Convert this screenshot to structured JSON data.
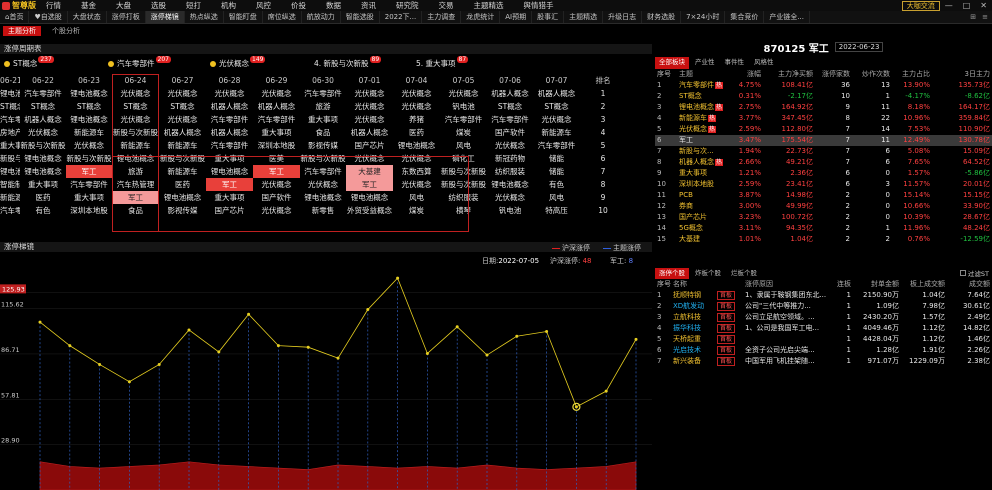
{
  "app": {
    "logo": "智尊版"
  },
  "menu": [
    "行情",
    "基金",
    "大盘",
    "选股",
    "短打",
    "机构",
    "风控",
    "价投",
    "数据",
    "资讯",
    "研究院",
    "交易",
    "主题精选",
    "舆情猎手"
  ],
  "help_label": "大咖交流",
  "win_controls": [
    "—",
    "□",
    "✕"
  ],
  "tabs": [
    {
      "label": "首页",
      "icon": "home-icon"
    },
    {
      "label": "自选股",
      "icon": "heart-icon"
    },
    {
      "label": "大盘状态"
    },
    {
      "label": "涨停打板"
    },
    {
      "label": "涨停梯镜",
      "active": true
    },
    {
      "label": "热点纵选"
    },
    {
      "label": "智能盯盘"
    },
    {
      "label": "席位纵选"
    },
    {
      "label": "航放动力"
    },
    {
      "label": "智能选股"
    },
    {
      "label": "2022下..."
    },
    {
      "label": "主力调查"
    },
    {
      "label": "龙虎统计"
    },
    {
      "label": "AI预期"
    },
    {
      "label": "股事汇"
    },
    {
      "label": "主题精选"
    },
    {
      "label": "升级日志"
    },
    {
      "label": "财务选股"
    },
    {
      "label": "7×24小时"
    },
    {
      "label": "集合竞价"
    },
    {
      "label": "产业链全..."
    }
  ],
  "subtabs": [
    {
      "label": "主题分析",
      "active": true
    },
    {
      "label": "个股分析"
    }
  ],
  "left": {
    "title": "涨停周期表",
    "top_themes": [
      {
        "name": "ST概念",
        "count": "237"
      },
      {
        "name": "汽车零部件",
        "count": "207"
      },
      {
        "name": "光伏概念",
        "count": "149"
      },
      {
        "name": "4. 新股与次新股",
        "count": "89"
      },
      {
        "name": "5. 重大事项",
        "count": "87"
      }
    ],
    "dates": [
      "06-21",
      "06-22",
      "06-23",
      "06-24",
      "06-27",
      "06-28",
      "06-29",
      "06-30",
      "07-01",
      "07-04",
      "07-05",
      "07-06",
      "07-07"
    ],
    "rank_label": "排名",
    "rows": [
      [
        [
          "锂电池概念",
          ""
        ],
        [
          "汽车零部件",
          ""
        ],
        [
          "锂电池概念",
          ""
        ],
        [
          "光伏概念",
          ""
        ],
        [
          "光伏概念",
          ""
        ],
        [
          "光伏概念",
          ""
        ],
        [
          "光伏概念",
          ""
        ],
        [
          "汽车零部件",
          ""
        ],
        [
          "光伏概念",
          ""
        ],
        [
          "光伏概念",
          ""
        ],
        [
          "光伏概念",
          ""
        ],
        [
          "机器人概念",
          ""
        ],
        [
          "机器人概念",
          ""
        ],
        [
          "1",
          ""
        ]
      ],
      [
        [
          "ST概念",
          ""
        ],
        [
          "ST概念",
          ""
        ],
        [
          "ST概念",
          ""
        ],
        [
          "ST概念",
          ""
        ],
        [
          "ST概念",
          ""
        ],
        [
          "机器人概念",
          ""
        ],
        [
          "机器人概念",
          ""
        ],
        [
          "旅游",
          ""
        ],
        [
          "光伏概念",
          ""
        ],
        [
          "光伏概念",
          ""
        ],
        [
          "钒电池",
          ""
        ],
        [
          "ST概念",
          ""
        ],
        [
          "ST概念",
          ""
        ],
        [
          "2",
          ""
        ]
      ],
      [
        [
          "汽车零部件",
          ""
        ],
        [
          "机器人概念",
          ""
        ],
        [
          "锂电池概念",
          ""
        ],
        [
          "光伏概念",
          ""
        ],
        [
          "光伏概念",
          ""
        ],
        [
          "汽车零部件",
          ""
        ],
        [
          "汽车零部件",
          ""
        ],
        [
          "重大事项",
          ""
        ],
        [
          "光伏概念",
          ""
        ],
        [
          "养猪",
          ""
        ],
        [
          "汽车零部件",
          ""
        ],
        [
          "汽车零部件",
          ""
        ],
        [
          "光伏概念",
          ""
        ],
        [
          "3",
          ""
        ]
      ],
      [
        [
          "房地产开发",
          ""
        ],
        [
          "光伏概念",
          ""
        ],
        [
          "新能源车",
          ""
        ],
        [
          "新股与次新股",
          ""
        ],
        [
          "机器人概念",
          ""
        ],
        [
          "机器人概念",
          ""
        ],
        [
          "重大事项",
          ""
        ],
        [
          "食品",
          ""
        ],
        [
          "机器人概念",
          ""
        ],
        [
          "医药",
          ""
        ],
        [
          "煤炭",
          ""
        ],
        [
          "国产软件",
          ""
        ],
        [
          "新能源车",
          ""
        ],
        [
          "4",
          ""
        ]
      ],
      [
        [
          "重大事项",
          ""
        ],
        [
          "新股与次新股",
          ""
        ],
        [
          "光伏概念",
          ""
        ],
        [
          "新能源车",
          ""
        ],
        [
          "新能源车",
          ""
        ],
        [
          "汽车零部件",
          ""
        ],
        [
          "深圳本地股",
          ""
        ],
        [
          "影视传媒",
          ""
        ],
        [
          "国产芯片",
          ""
        ],
        [
          "锂电池概念",
          ""
        ],
        [
          "风电",
          ""
        ],
        [
          "光伏概念",
          ""
        ],
        [
          "汽车零部件",
          ""
        ],
        [
          "5",
          ""
        ]
      ],
      [
        [
          "新股与次新股",
          ""
        ],
        [
          "锂电池概念",
          ""
        ],
        [
          "新股与次新股",
          ""
        ],
        [
          "锂电池概念",
          ""
        ],
        [
          "新股与次新股",
          ""
        ],
        [
          "重大事项",
          ""
        ],
        [
          "医美",
          ""
        ],
        [
          "新股与次新股",
          ""
        ],
        [
          "光伏概念",
          ""
        ],
        [
          "光伏概念",
          ""
        ],
        [
          "磷化工",
          ""
        ],
        [
          "新冠药物",
          ""
        ],
        [
          "储能",
          ""
        ],
        [
          "6",
          ""
        ]
      ],
      [
        [
          "锂电池概念",
          ""
        ],
        [
          "锂电池概念",
          ""
        ],
        [
          "军工",
          "red"
        ],
        [
          "旅游",
          ""
        ],
        [
          "新能源车",
          ""
        ],
        [
          "锂电池概念",
          ""
        ],
        [
          "军工",
          "red"
        ],
        [
          "汽车零部件",
          ""
        ],
        [
          "大基建",
          "pink"
        ],
        [
          "东数西算",
          ""
        ],
        [
          "新股与次新股",
          ""
        ],
        [
          "纺织服装",
          ""
        ],
        [
          "储能",
          ""
        ],
        [
          "7",
          ""
        ]
      ],
      [
        [
          "智能制造",
          ""
        ],
        [
          "重大事项",
          ""
        ],
        [
          "汽车零部件",
          ""
        ],
        [
          "汽车热管理",
          ""
        ],
        [
          "医药",
          ""
        ],
        [
          "军工",
          "red"
        ],
        [
          "光伏概念",
          ""
        ],
        [
          "光伏概念",
          ""
        ],
        [
          "军工",
          "pink"
        ],
        [
          "光伏概念",
          ""
        ],
        [
          "新股与次新股",
          ""
        ],
        [
          "锂电池概念",
          ""
        ],
        [
          "有色",
          ""
        ],
        [
          "8",
          ""
        ]
      ],
      [
        [
          "新能源车",
          ""
        ],
        [
          "医药",
          ""
        ],
        [
          "重大事项",
          ""
        ],
        [
          "军工",
          "pink"
        ],
        [
          "锂电池概念",
          ""
        ],
        [
          "重大事项",
          ""
        ],
        [
          "国产软件",
          ""
        ],
        [
          "锂电池概念",
          ""
        ],
        [
          "锂电池概念",
          ""
        ],
        [
          "风电",
          ""
        ],
        [
          "纺织服装",
          ""
        ],
        [
          "光伏概念",
          ""
        ],
        [
          "风电",
          ""
        ],
        [
          "9",
          ""
        ]
      ],
      [
        [
          "汽车零部件",
          ""
        ],
        [
          "有色",
          ""
        ],
        [
          "深圳本地股",
          ""
        ],
        [
          "食品",
          ""
        ],
        [
          "影视传媒",
          ""
        ],
        [
          "国产芯片",
          ""
        ],
        [
          "光伏概念",
          ""
        ],
        [
          "新零售",
          ""
        ],
        [
          "外贸受益概念",
          ""
        ],
        [
          "煤炭",
          ""
        ],
        [
          "横琴",
          ""
        ],
        [
          "钒电池",
          ""
        ],
        [
          "特高压",
          ""
        ],
        [
          "10",
          ""
        ]
      ]
    ]
  },
  "chart": {
    "title": "涨停梯镜",
    "legend": [
      {
        "name": "沪深涨停",
        "color": "#e02020"
      },
      {
        "name": "主题涨停",
        "color": "#3060e0"
      }
    ],
    "info": {
      "date_label": "日期:",
      "date": "2022-07-05",
      "hs_label": "沪深涨停:",
      "hs": "48",
      "zt_label": "军工:",
      "zt": "8"
    }
  },
  "chart_data": {
    "type": "line",
    "y_ticks": [
      "125.93",
      "115.62",
      "86.71",
      "57.81",
      "28.90"
    ],
    "ylim": [
      0,
      130
    ],
    "series": [
      {
        "values": [
          107,
          92,
          80,
          69,
          80,
          102,
          88,
          112,
          92,
          91,
          84,
          115,
          135,
          87,
          104,
          86,
          98,
          101,
          53,
          63,
          96
        ]
      },
      {
        "values": [
          18,
          15,
          14,
          15,
          16,
          18,
          16,
          15,
          14,
          13,
          16,
          15,
          14,
          15,
          14,
          16,
          14,
          13,
          14,
          15,
          18
        ]
      }
    ]
  },
  "right": {
    "code": "870125 军工",
    "date": "2022-06-23",
    "tabs": [
      {
        "label": "全部板块",
        "active": true
      },
      {
        "label": "产业性"
      },
      {
        "label": "事件性"
      },
      {
        "label": "风格性"
      }
    ],
    "headers": [
      "序号",
      "主题",
      "涨幅",
      "主力净买额",
      "涨停家数",
      "炒作次数",
      "主力占比",
      "3日主力"
    ],
    "rows": [
      {
        "no": "1",
        "name": "汽车零部件",
        "hot": true,
        "chg": "4.75%",
        "buy": "108.41亿",
        "zt": "36",
        "times": "13",
        "pct": "13.90%",
        "d3": "135.73亿",
        "d3c": "rd"
      },
      {
        "no": "2",
        "name": "ST概念",
        "hot": false,
        "chg": "0.31%",
        "buy": "-2.17亿",
        "buyc": "gn",
        "zt": "10",
        "times": "1",
        "pct": "-4.17%",
        "pctc": "gn",
        "d3": "-8.62亿",
        "d3c": "gn"
      },
      {
        "no": "3",
        "name": "锂电池概念",
        "hot": true,
        "chg": "2.75%",
        "buy": "164.92亿",
        "zt": "9",
        "times": "11",
        "pct": "8.18%",
        "d3": "164.17亿",
        "d3c": "rd"
      },
      {
        "no": "4",
        "name": "新能源车",
        "hot": true,
        "chg": "3.77%",
        "buy": "347.45亿",
        "zt": "8",
        "times": "22",
        "pct": "10.96%",
        "d3": "359.84亿",
        "d3c": "rd"
      },
      {
        "no": "5",
        "name": "光伏概念",
        "hot": true,
        "chg": "2.59%",
        "buy": "112.80亿",
        "zt": "7",
        "times": "14",
        "pct": "7.53%",
        "d3": "110.90亿",
        "d3c": "rd"
      },
      {
        "no": "6",
        "name": "军工",
        "hot": false,
        "sel": true,
        "chg": "3.47%",
        "buy": "175.54亿",
        "zt": "7",
        "times": "11",
        "pct": "12.49%",
        "d3": "130.78亿",
        "d3c": "rd"
      },
      {
        "no": "7",
        "name": "新股与次...",
        "hot": false,
        "chg": "1.94%",
        "buy": "22.73亿",
        "zt": "7",
        "times": "6",
        "pct": "5.08%",
        "d3": "15.09亿",
        "d3c": "rd"
      },
      {
        "no": "8",
        "name": "机器人概念",
        "hot": true,
        "chg": "2.66%",
        "buy": "49.21亿",
        "zt": "7",
        "times": "6",
        "pct": "7.65%",
        "d3": "64.52亿",
        "d3c": "rd"
      },
      {
        "no": "9",
        "name": "重大事项",
        "hot": false,
        "chg": "1.21%",
        "buy": "2.36亿",
        "zt": "6",
        "times": "0",
        "pct": "1.57%",
        "d3": "-5.86亿",
        "d3c": "gn"
      },
      {
        "no": "10",
        "name": "深圳本地股",
        "hot": false,
        "chg": "2.59%",
        "buy": "23.41亿",
        "zt": "6",
        "times": "3",
        "pct": "11.57%",
        "d3": "20.01亿",
        "d3c": "rd"
      },
      {
        "no": "11",
        "name": "PCB",
        "hot": false,
        "chg": "3.87%",
        "buy": "14.98亿",
        "zt": "2",
        "times": "0",
        "pct": "15.14%",
        "d3": "15.15亿",
        "d3c": "rd"
      },
      {
        "no": "12",
        "name": "券商",
        "hot": false,
        "chg": "3.00%",
        "buy": "49.99亿",
        "zt": "2",
        "times": "0",
        "pct": "10.66%",
        "d3": "33.90亿",
        "d3c": "rd"
      },
      {
        "no": "13",
        "name": "国产芯片",
        "hot": false,
        "chg": "3.23%",
        "buy": "100.72亿",
        "zt": "2",
        "times": "0",
        "pct": "10.39%",
        "d3": "28.67亿",
        "d3c": "rd"
      },
      {
        "no": "14",
        "name": "5G概念",
        "hot": false,
        "chg": "3.11%",
        "buy": "94.35亿",
        "zt": "2",
        "times": "1",
        "pct": "11.96%",
        "d3": "48.24亿",
        "d3c": "rd"
      },
      {
        "no": "15",
        "name": "大基建",
        "hot": false,
        "chg": "1.01%",
        "buy": "1.04亿",
        "zt": "2",
        "times": "2",
        "pct": "0.76%",
        "d3": "-12.59亿",
        "d3c": "gn"
      }
    ],
    "tabs2": [
      {
        "label": "涨停个股",
        "active": true
      },
      {
        "label": "炸板个股"
      },
      {
        "label": "烂板个股"
      }
    ],
    "filter_label": "过滤ST",
    "headers2": [
      "序号",
      "名称",
      "",
      "涨停原因",
      "连板",
      "封单金额",
      "板上成交额",
      "成交额"
    ],
    "stocks": [
      {
        "no": "1",
        "name": "抚顺特钢",
        "nc": "yel",
        "tag": "首板",
        "reason": "1、隶属于鞍钢集团东北...",
        "lb": "1",
        "fd": "2150.90万",
        "bs": "1.04亿",
        "cj": "7.64亿"
      },
      {
        "no": "2",
        "name": "XD航发动",
        "nc": "cy",
        "tag": "首板",
        "reason": "公司\"三代中等推力...",
        "lb": "1",
        "fd": "1.09亿",
        "bs": "7.98亿",
        "cj": "30.61亿"
      },
      {
        "no": "3",
        "name": "立航科技",
        "nc": "yel",
        "tag": "首板",
        "reason": "公司立足航空领域。...",
        "lb": "1",
        "fd": "2430.20万",
        "bs": "1.57亿",
        "cj": "2.49亿"
      },
      {
        "no": "4",
        "name": "振华科技",
        "nc": "cy",
        "tag": "首板",
        "reason": "1、公司是我国军工电...",
        "lb": "1",
        "fd": "4049.46万",
        "bs": "1.12亿",
        "cj": "14.82亿"
      },
      {
        "no": "5",
        "name": "天桥起重",
        "nc": "yel",
        "tag": "首板",
        "reason": "",
        "lb": "1",
        "fd": "4428.04万",
        "bs": "1.12亿",
        "cj": "1.46亿"
      },
      {
        "no": "6",
        "name": "光启技术",
        "nc": "cy",
        "tag": "首板",
        "reason": "全资子公司光启尖端...",
        "lb": "1",
        "fd": "1.28亿",
        "bs": "1.91亿",
        "cj": "2.26亿"
      },
      {
        "no": "7",
        "name": "新兴装备",
        "nc": "yel",
        "tag": "首板",
        "reason": "中国军用飞机挂架随...",
        "lb": "1",
        "fd": "971.07万",
        "bs": "1229.09万",
        "cj": "2.38亿"
      }
    ]
  }
}
